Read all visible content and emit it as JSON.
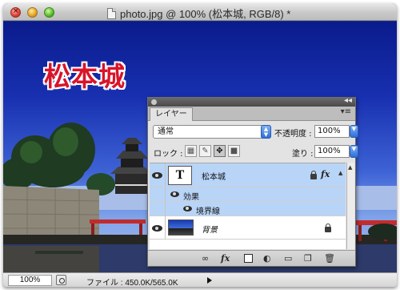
{
  "window": {
    "title": "photo.jpg @ 100% (松本城, RGB/8) *"
  },
  "canvas": {
    "heading_text": "松本城"
  },
  "layers_panel": {
    "tab_label": "レイヤー",
    "blend_mode": "通常",
    "opacity_label": "不透明度 :",
    "opacity_value": "100%",
    "lock_label": "ロック :",
    "fill_label": "塗り :",
    "fill_value": "100%",
    "layers": [
      {
        "name": "松本城",
        "type": "text",
        "thumb_glyph": "T",
        "selected": true,
        "fx": "fx",
        "effects_label": "効果",
        "effects": [
          "境界線"
        ]
      },
      {
        "name": "背景",
        "type": "image",
        "selected": false,
        "locked": true
      }
    ],
    "bottom_icons": [
      "link-icon",
      "fx-icon",
      "mask-icon",
      "adjustment-icon",
      "group-folder-icon",
      "new-layer-icon",
      "trash-icon"
    ],
    "fx_glyph": "fx"
  },
  "statusbar": {
    "zoom": "100%",
    "file_info": "ファイル : 450.0K/565.0K"
  }
}
